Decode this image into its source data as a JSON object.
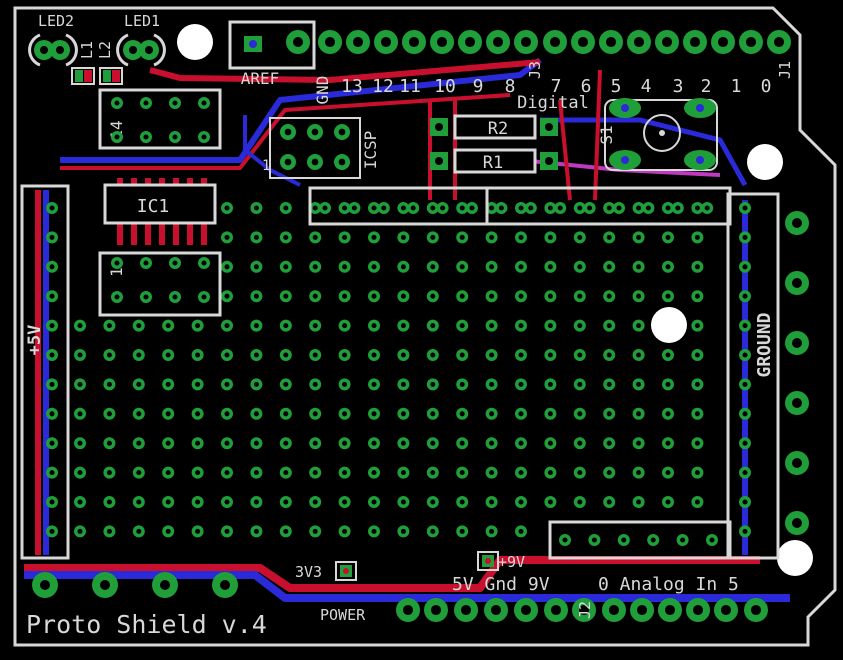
{
  "board": {
    "title": "Proto Shield v.4",
    "colors": {
      "background": "#000000",
      "silkscreen": "#d8d8d8",
      "pad_ring": "#1f9e3a",
      "pad_hole": "#000000",
      "top_trace": "#c8102e",
      "bottom_trace": "#2a2ad8",
      "via_trace": "#c03ac0"
    }
  },
  "labels": {
    "led2": "LED2",
    "led1": "LED1",
    "l1": "L1",
    "l2": "L2",
    "aref": "AREF",
    "gnd_top": "GND",
    "j3": "J3",
    "j1": "J1",
    "digital": "Digital",
    "r2": "R2",
    "r1": "R1",
    "s1": "S1",
    "icsp": "ICSP",
    "icsp_pin1": "1",
    "ic1": "IC1",
    "ic_top_pin": "14",
    "ic_bottom_pin": "1",
    "plus5v": "+5V",
    "ground": "GROUND",
    "v3v3": "3V3",
    "plus9v": "+9V",
    "power": "POWER",
    "j2": "J2",
    "power_header": "5V Gnd 9V",
    "analog_header": "0 Analog In 5"
  },
  "digital_pins": [
    "13",
    "12",
    "11",
    "10",
    "9",
    "8",
    "7",
    "6",
    "5",
    "4",
    "3",
    "2",
    "1",
    "0"
  ]
}
